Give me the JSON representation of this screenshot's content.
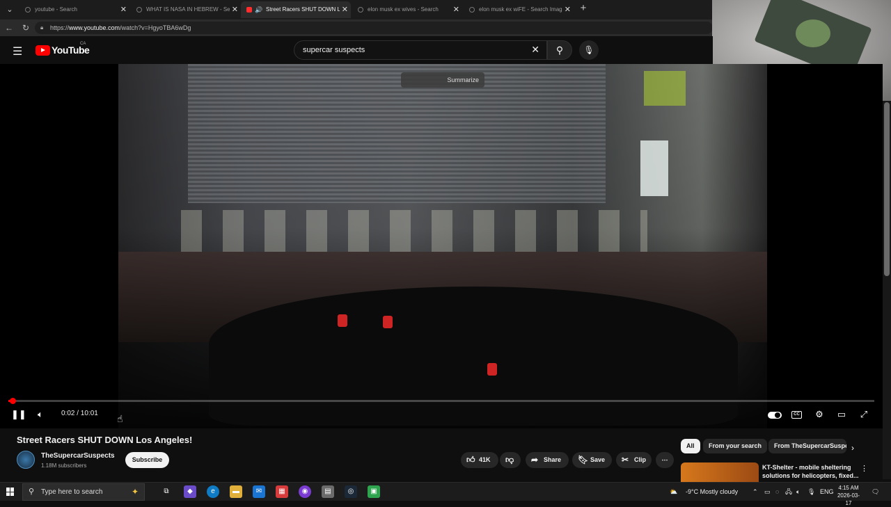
{
  "browser": {
    "tabs": [
      {
        "title": "youtube - Search"
      },
      {
        "title": "WHAT IS NASA IN HEBREW - Search"
      },
      {
        "title": "Street Racers SHUT DOWN Los Angeles!"
      },
      {
        "title": "elon musk ex wives - Search"
      },
      {
        "title": "elon musk ex wiFE - Search Images"
      }
    ],
    "url_prefix": "https://",
    "url_domain": "www.youtube.com",
    "url_path": "/watch?v=HgyoTBA6wDg"
  },
  "youtube": {
    "logo_text": "YouTube",
    "region": "CA",
    "search_value": "supercar suspects"
  },
  "player": {
    "summarize_label": "Summarize",
    "current_time": "0:02",
    "duration": "10:01",
    "time_display": "0:02 / 10:01",
    "progress_fraction": 0.003,
    "cc_label": "CC"
  },
  "video": {
    "title": "Street Racers SHUT DOWN Los Angeles!",
    "channel_name": "TheSupercarSuspects",
    "subscribers": "1.18M subscribers",
    "subscribe_label": "Subscribe",
    "like_count": "41K",
    "share_label": "Share",
    "save_label": "Save",
    "clip_label": "Clip"
  },
  "sidebar": {
    "chips": [
      "All",
      "From your search",
      "From TheSupercarSuspects"
    ],
    "recommendation_title": "KT-Shelter - mobile sheltering solutions for helicopters, fixed..."
  },
  "taskbar": {
    "search_placeholder": "Type here to search",
    "weather": "-9°C  Mostly cloudy",
    "language": "ENG",
    "time": "4:15 AM",
    "date": "2026-03-17"
  },
  "icons": {
    "tab_menu": "chevron-down-icon",
    "back": "back-arrow-icon",
    "refresh": "refresh-icon",
    "search": "search-icon",
    "mic": "mic-icon",
    "like": "thumbs-up-icon",
    "dislike": "thumbs-down-icon"
  },
  "colors": {
    "youtube_red": "#ff0000",
    "background": "#0f0f0f",
    "pill": "#272727"
  }
}
